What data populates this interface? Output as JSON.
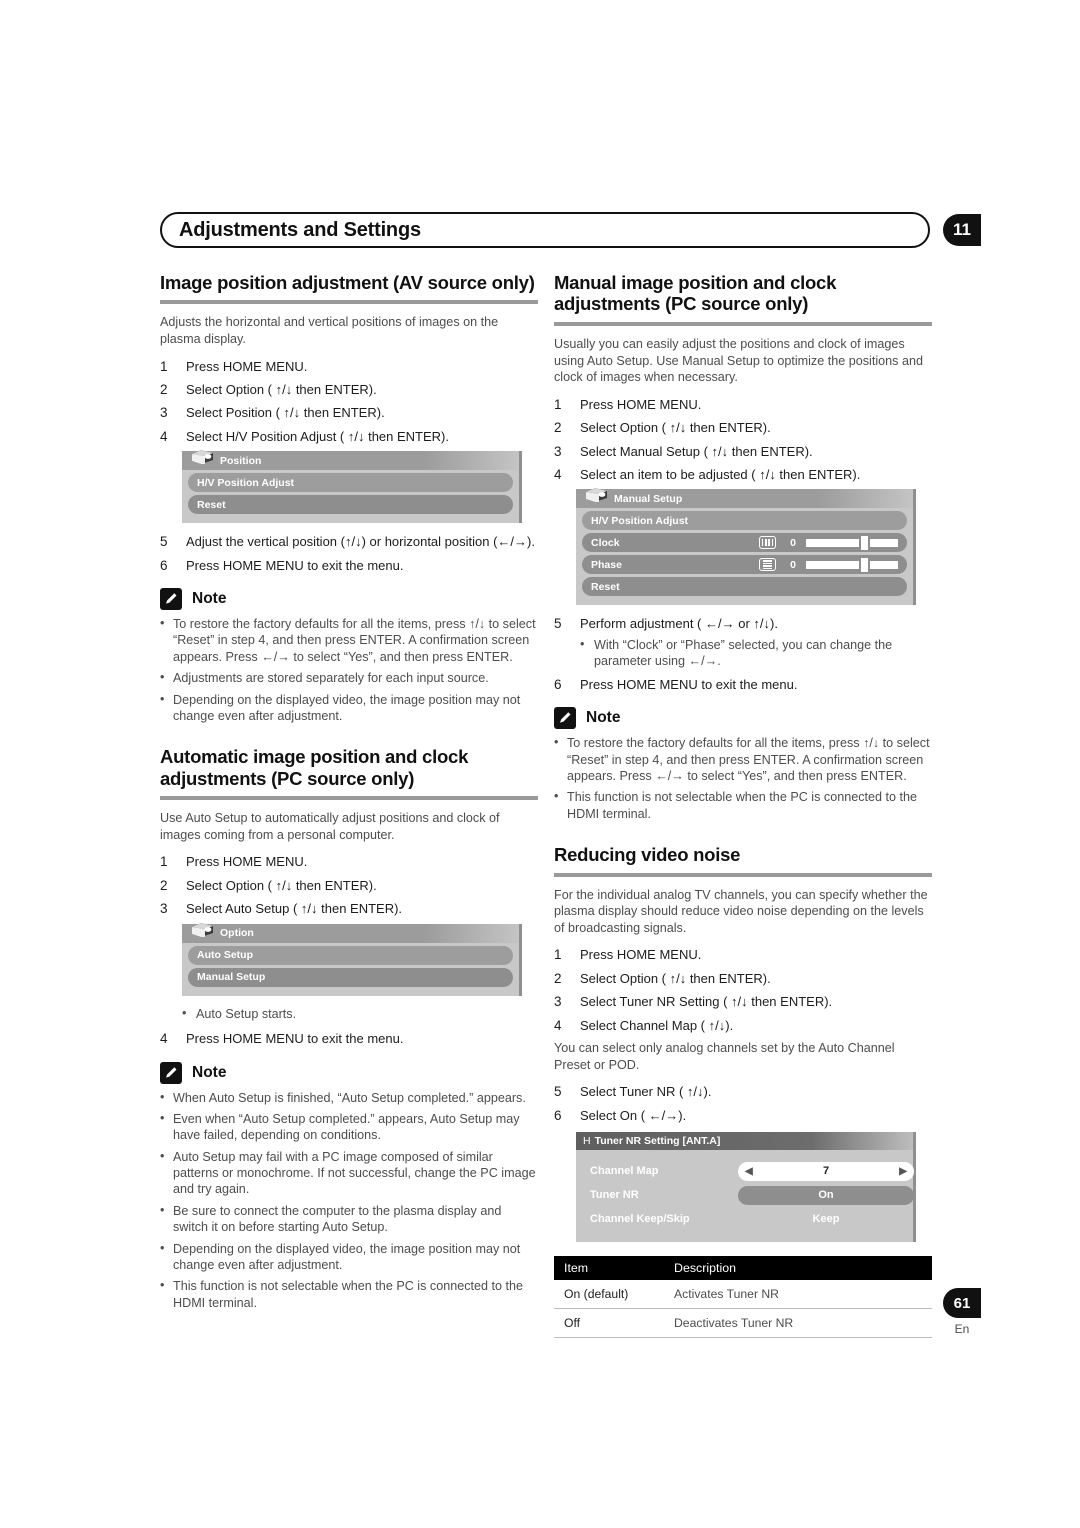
{
  "header": {
    "title": "Adjustments and Settings",
    "chapter": "11"
  },
  "footer": {
    "page_number": "61",
    "language": "En"
  },
  "left_column": {
    "section1": {
      "heading": "Image position adjustment (AV source only)",
      "intro": "Adjusts the horizontal and vertical positions of images on the plasma display.",
      "steps": [
        {
          "n": "1",
          "text": "Press HOME MENU."
        },
        {
          "n": "2",
          "text": "Select  Option  (  ↑/↓ then ENTER)."
        },
        {
          "n": "3",
          "text": "Select  Position  (  ↑/↓ then ENTER)."
        },
        {
          "n": "4",
          "text": "Select  H/V Position Adjust  (  ↑/↓ then ENTER)."
        }
      ],
      "osd": {
        "title": "Position",
        "rows": [
          "H/V Position Adjust",
          "Reset"
        ]
      },
      "steps2": [
        {
          "n": "5",
          "text": "Adjust the vertical position      (↑/↓) or horizontal position (←/→)."
        },
        {
          "n": "6",
          "text": "Press HOME MENU to exit the menu."
        }
      ],
      "note": {
        "label": "Note",
        "items": [
          "To restore the factory defaults for all the items, press ↑/↓ to select “Reset” in step 4, and then press ENTER. A confirmation screen appears. Press ←/→ to select “Yes”, and then press ENTER.",
          "Adjustments are stored separately for each input source.",
          "Depending on the displayed video, the image position may not change even after adjustment."
        ]
      }
    },
    "section2": {
      "heading": "Automatic image position and clock adjustments (PC source only)",
      "intro": "Use Auto Setup to automatically adjust positions and clock of images coming from a personal computer.",
      "steps": [
        {
          "n": "1",
          "text": "Press HOME MENU."
        },
        {
          "n": "2",
          "text": "Select  Option  (  ↑/↓ then ENTER)."
        },
        {
          "n": "3",
          "text": "Select  Auto Setup  (  ↑/↓ then ENTER)."
        }
      ],
      "osd": {
        "title": "Option",
        "rows": [
          "Auto Setup",
          "Manual Setup"
        ]
      },
      "substep": "Auto Setup starts.",
      "steps2": [
        {
          "n": "4",
          "text": "Press HOME MENU to exit the menu."
        }
      ],
      "note": {
        "label": "Note",
        "items": [
          "When Auto Setup is finished, “Auto Setup completed.” appears.",
          "Even when “Auto Setup completed.” appears, Auto Setup may have failed, depending on conditions.",
          "Auto Setup may fail with a PC image composed of similar patterns or monochrome. If not successful, change the PC image and try again.",
          "Be sure to connect the computer to the plasma display and switch it on before starting Auto Setup.",
          "Depending on the displayed video, the image position may not change even after adjustment.",
          "This function is not selectable when the PC is connected to the HDMI terminal."
        ]
      }
    }
  },
  "right_column": {
    "section1": {
      "heading": "Manual image position and clock adjustments (PC source only)",
      "intro": "Usually you can easily adjust the positions and clock of images using Auto Setup. Use Manual Setup to optimize the positions and clock of images when necessary.",
      "steps": [
        {
          "n": "1",
          "text": "Press HOME MENU."
        },
        {
          "n": "2",
          "text": "Select  Option  (  ↑/↓ then ENTER)."
        },
        {
          "n": "3",
          "text": "Select  Manual Setup  (  ↑/↓ then ENTER)."
        },
        {
          "n": "4",
          "text": "Select an item to be adjusted (  ↑/↓ then ENTER)."
        }
      ],
      "osd": {
        "title": "Manual Setup",
        "row_plain": "H/V Position Adjust",
        "sliders": [
          {
            "label": "Clock",
            "value": "0",
            "icon": "bars",
            "knob_pct": 58
          },
          {
            "label": "Phase",
            "value": "0",
            "icon": "lines",
            "knob_pct": 58
          }
        ],
        "row_reset": "Reset"
      },
      "steps2": [
        {
          "n": "5",
          "text": "Perform adjustment (  ←/→ or  ↑/↓)."
        },
        {
          "n": "6",
          "text": "Press HOME MENU to exit the menu."
        }
      ],
      "substep": "With “Clock” or “Phase” selected, you can change the parameter using ←/→.",
      "note": {
        "label": "Note",
        "items": [
          "To restore the factory defaults for all the items, press ↑/↓ to select “Reset” in step 4, and then press ENTER. A confirmation screen appears. Press ←/→ to select “Yes”, and then press ENTER.",
          "This function is not selectable when the PC is connected to the HDMI terminal."
        ]
      }
    },
    "section2": {
      "heading": "Reducing video noise",
      "intro": "For the individual analog TV channels, you can specify whether the plasma display should reduce video noise depending on the levels of broadcasting signals.",
      "steps": [
        {
          "n": "1",
          "text": "Press HOME MENU."
        },
        {
          "n": "2",
          "text": "Select  Option  (  ↑/↓ then ENTER)."
        },
        {
          "n": "3",
          "text": "Select  Tuner NR Setting  (  ↑/↓ then ENTER)."
        },
        {
          "n": "4",
          "text": "Select  Channel Map  (  ↑/↓)."
        }
      ],
      "note_text": "You can select only analog channels set by the Auto Channel Preset or POD.",
      "steps2": [
        {
          "n": "5",
          "text": "Select  Tuner NR  (  ↑/↓)."
        },
        {
          "n": "6",
          "text": "Select  On  (  ←/→)."
        }
      ],
      "osd": {
        "title_prefix": "H",
        "title": "Tuner NR Setting  [ANT.A]",
        "lines": [
          {
            "label": "Channel Map",
            "value": "7",
            "style": "stepper"
          },
          {
            "label": "Tuner NR",
            "value": "On",
            "style": "dark-pill"
          },
          {
            "label": "Channel  Keep/Skip",
            "value": "Keep",
            "style": "plain"
          }
        ]
      },
      "table": {
        "headers": [
          "Item",
          "Description"
        ],
        "rows": [
          [
            "On (default)",
            "Activates Tuner NR"
          ],
          [
            "Off",
            "Deactivates Tuner NR"
          ]
        ]
      }
    }
  }
}
